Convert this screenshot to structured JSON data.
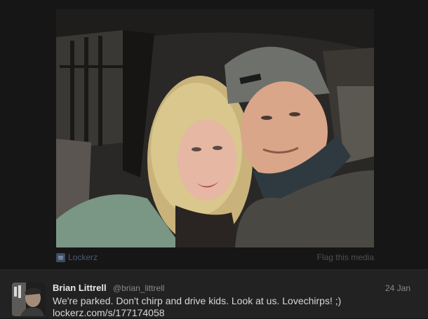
{
  "media": {
    "provider_name": "Lockerz",
    "provider_icon": "lockerz-icon",
    "flag_label": "Flag this media"
  },
  "tweet": {
    "fullname": "Brian Littrell",
    "username": "@brian_littrell",
    "timestamp": "24 Jan",
    "text": "We're parked. Don't chirp and drive kids. Look at us. Lovechirps! ;)",
    "link": "lockerz.com/s/177174058"
  },
  "colors": {
    "background": "#141414",
    "tweet_background": "#222222",
    "name": "#e9e9e9",
    "meta": "#8a8a8a",
    "text": "#d7d7d7"
  }
}
